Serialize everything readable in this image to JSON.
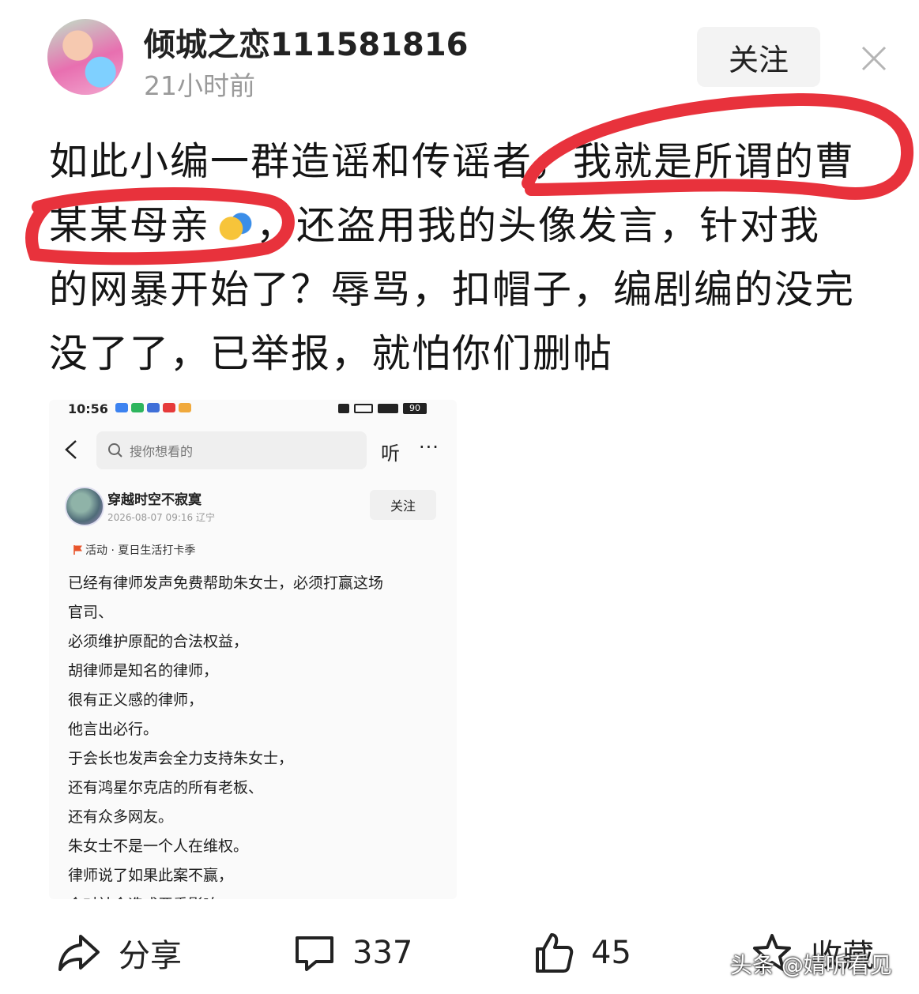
{
  "author": {
    "name": "倾城之恋111581816",
    "time": "21小时前",
    "follow_label": "关注"
  },
  "post": {
    "lines": [
      "如此小编一群造谣和传谣者，我就是所谓的曹",
      "某某母亲",
      "，还盗用我的头像发言，针对我",
      "的网暴开始了？辱骂，扣帽子，编剧编的没完",
      "没了了，已举报，就怕你们删帖"
    ],
    "highlight_color": "#e8323c"
  },
  "embedded": {
    "status_time": "10:56",
    "battery": "90",
    "search_placeholder": "搜你想看的",
    "listen_label": "听",
    "more_label": "···",
    "author_name": "穿越时空不寂寞",
    "author_meta": "2026-08-07 09:16 辽宁",
    "follow_label": "关注",
    "activity": "活动 · 夏日生活打卡季",
    "body_lines": [
      "已经有律师发声免费帮助朱女士，必须打赢这场",
      "官司、",
      "必须维护原配的合法权益，",
      "胡律师是知名的律师，",
      "很有正义感的律师，",
      "他言出必行。",
      "于会长也发声会全力支持朱女士，",
      "还有鸿星尔克店的所有老板、",
      "还有众多网友。",
      "朱女士不是一个人在维权。",
      "律师说了如果此案不赢，",
      "会对社会造成严重影响"
    ]
  },
  "actions": {
    "share_label": "分享",
    "comment_count": "337",
    "like_count": "45",
    "collect_label": "收藏"
  },
  "watermark": "头条 @婧听看见"
}
